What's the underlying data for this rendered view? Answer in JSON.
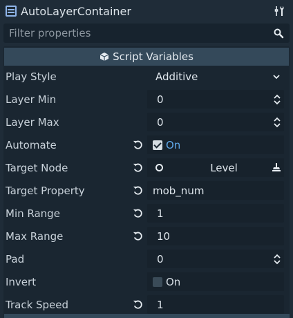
{
  "header": {
    "title": "AutoLayerContainer",
    "node_icon": "container-node-icon",
    "tools_icon": "tools-icon"
  },
  "filter": {
    "placeholder": "Filter properties",
    "value": ""
  },
  "section": {
    "title": "Script Variables",
    "icon": "cube-icon"
  },
  "properties": {
    "play_style": {
      "label": "Play Style",
      "value": "Additive"
    },
    "layer_min": {
      "label": "Layer Min",
      "value": "0"
    },
    "layer_max": {
      "label": "Layer Max",
      "value": "0"
    },
    "automate": {
      "label": "Automate",
      "checked": true,
      "value": "On"
    },
    "target_node": {
      "label": "Target Node",
      "value": "Level"
    },
    "target_property": {
      "label": "Target Property",
      "value": "mob_num"
    },
    "min_range": {
      "label": "Min Range",
      "value": "1"
    },
    "max_range": {
      "label": "Max Range",
      "value": "10"
    },
    "pad": {
      "label": "Pad",
      "value": "0"
    },
    "invert": {
      "label": "Invert",
      "checked": false,
      "value": "On"
    },
    "track_speed": {
      "label": "Track Speed",
      "value": "1"
    }
  },
  "colors": {
    "background": "#1f2c38",
    "section_header": "#34495a",
    "accent_on": "#5fa7e8"
  }
}
